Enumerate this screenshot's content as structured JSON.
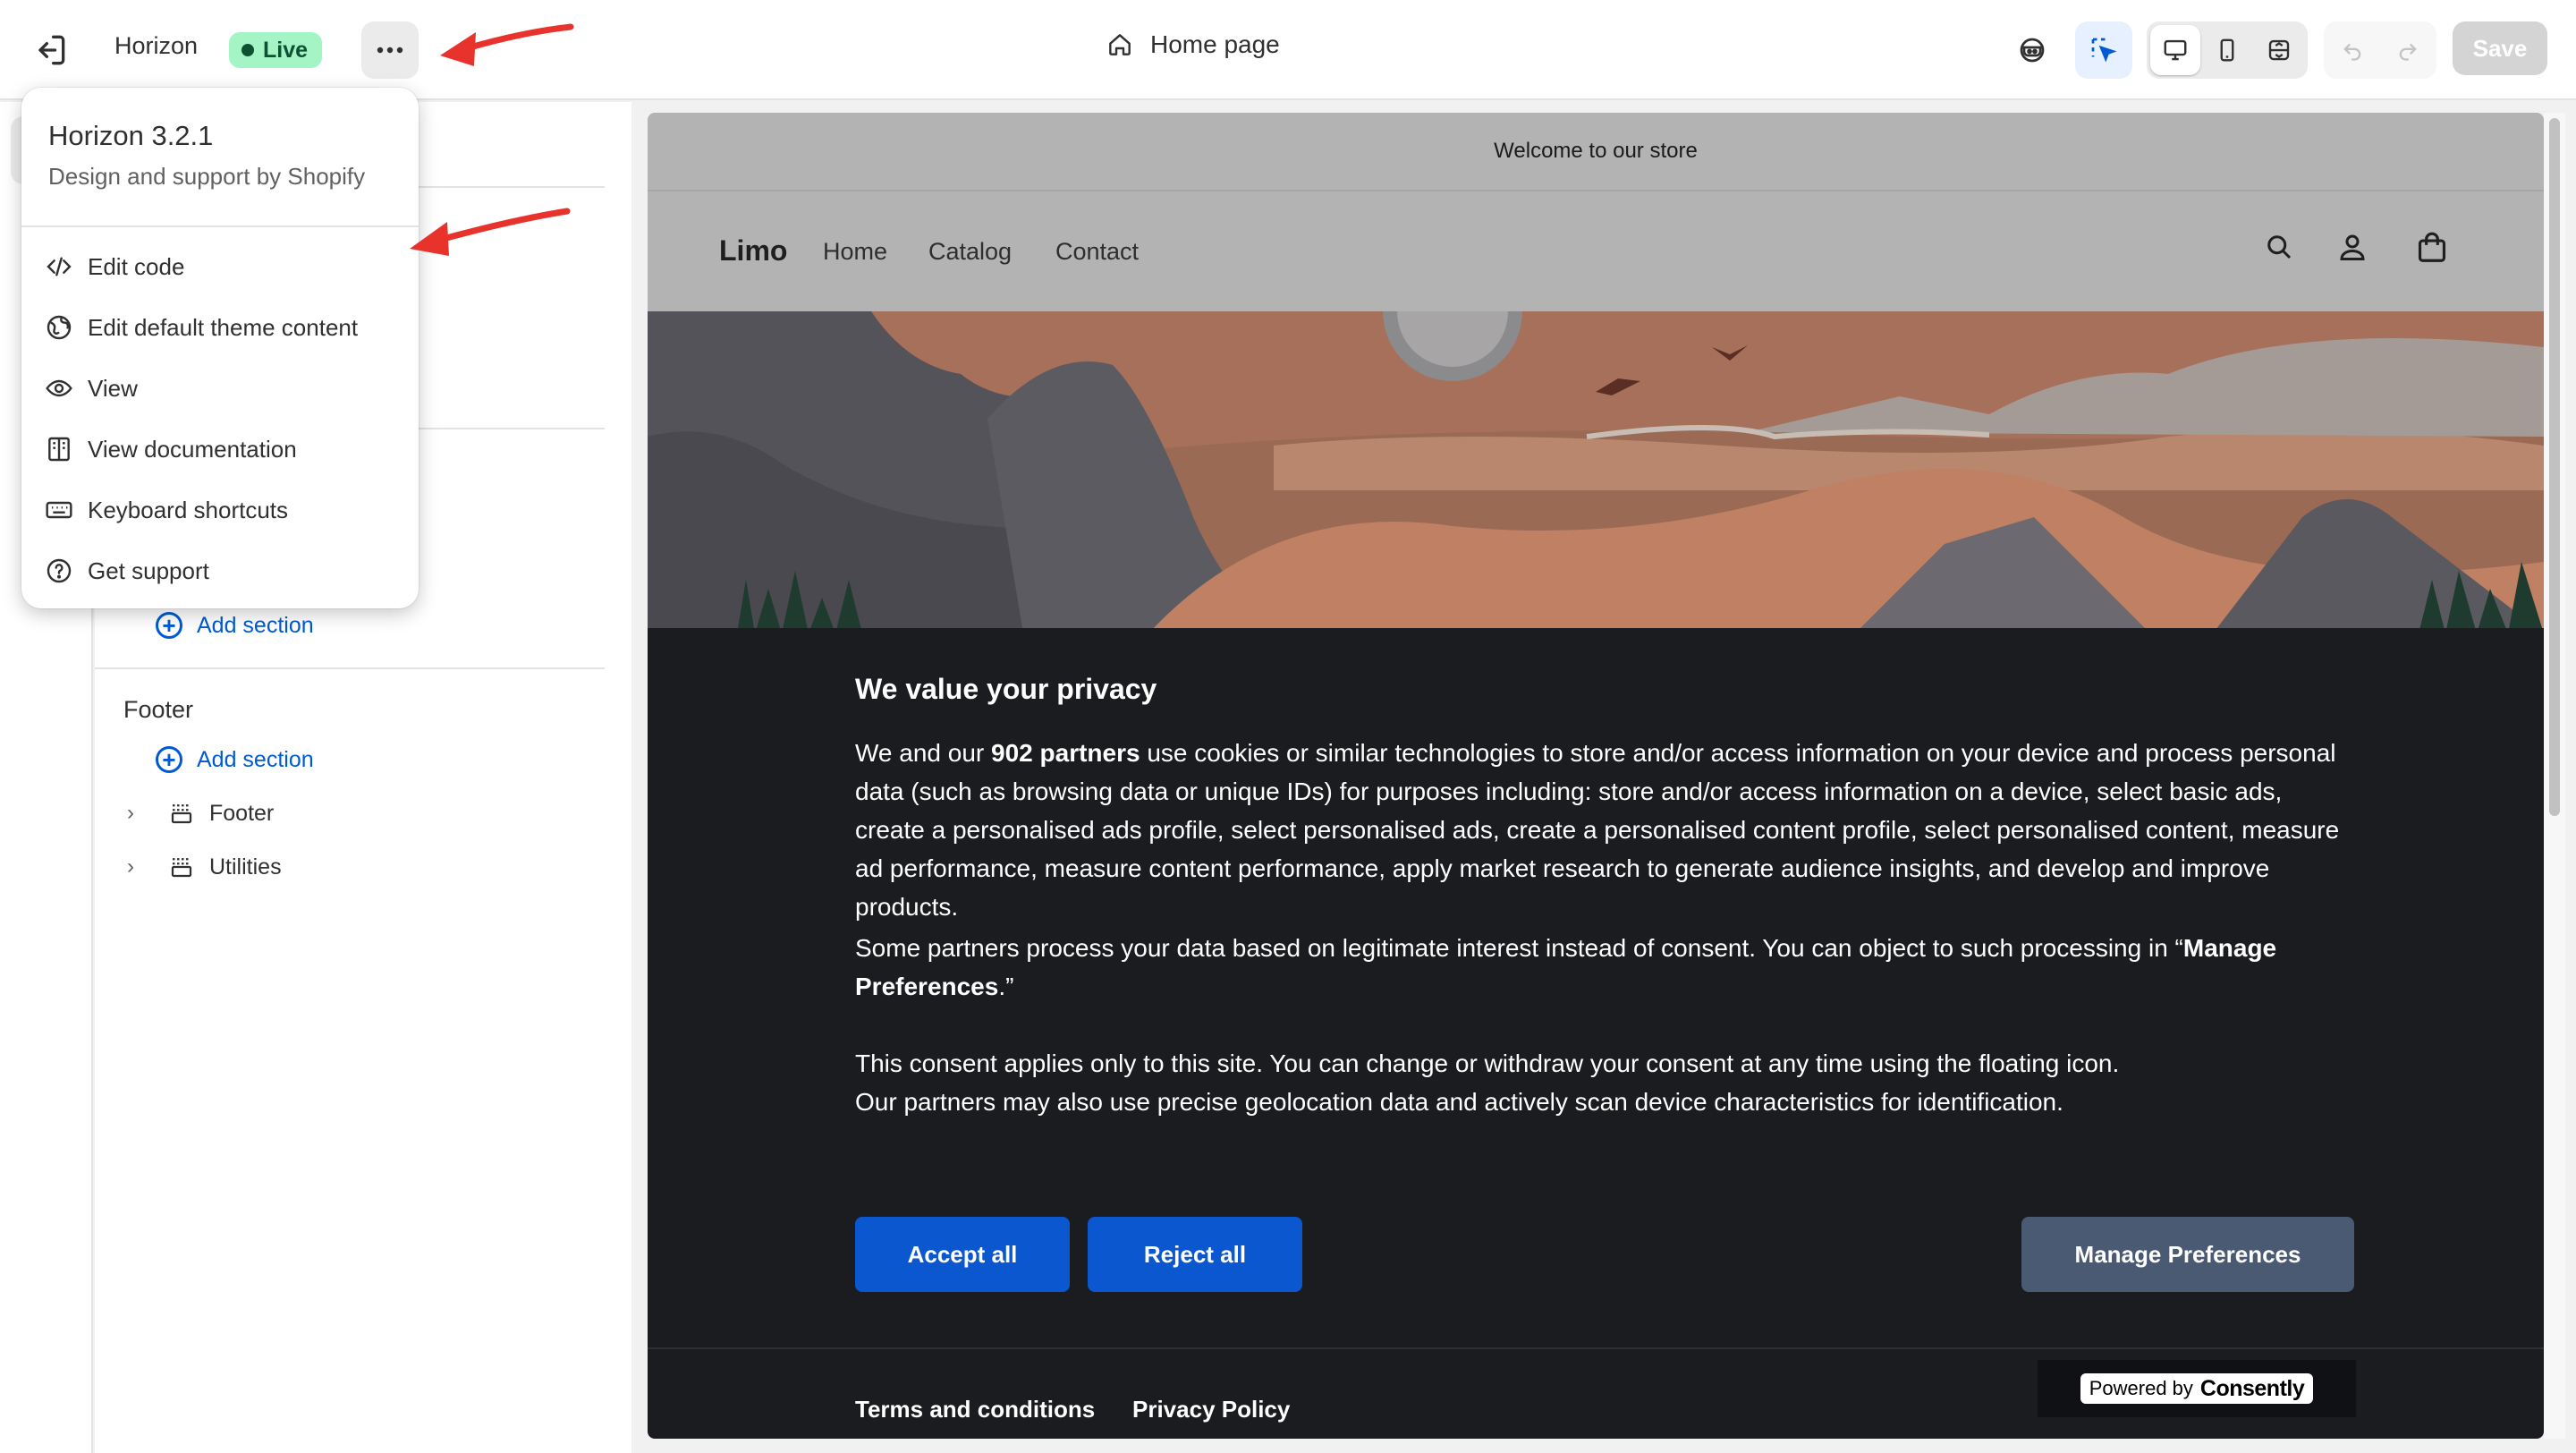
{
  "topbar": {
    "theme_name": "Horizon",
    "live_label": "Live",
    "page_label": "Home page",
    "save_label": "Save"
  },
  "menu": {
    "theme_name": "Horizon",
    "version": "3.2.1",
    "subtitle": "Design and support by Shopify",
    "items": [
      {
        "label": "Edit code",
        "icon": "code-icon"
      },
      {
        "label": "Edit default theme content",
        "icon": "globe-icon"
      },
      {
        "label": "View",
        "icon": "eye-icon"
      },
      {
        "label": "View documentation",
        "icon": "book-icon"
      },
      {
        "label": "Keyboard shortcuts",
        "icon": "keyboard-icon"
      },
      {
        "label": "Get support",
        "icon": "question-icon"
      }
    ]
  },
  "sidebar": {
    "add_section_label": "Add section",
    "footer_heading": "Footer",
    "footer_items": [
      {
        "label": "Footer"
      },
      {
        "label": "Utilities"
      }
    ]
  },
  "preview": {
    "announcement": "Welcome to our store",
    "logo": "Limo",
    "nav": [
      "Home",
      "Catalog",
      "Contact"
    ],
    "privacy": {
      "title": "We value your privacy",
      "p1_prefix": "We and our ",
      "p1_bold": "902 partners",
      "p1_rest": " use cookies or similar technologies to store and/or access information on your device and process personal data (such as browsing data or unique IDs) for purposes including: store and/or access information on a device, select basic ads, create a personalised ads profile, select personalised ads, create a personalised content profile, select personalised content, measure ad performance, measure content performance, apply market research to generate audience insights, and develop and improve products.",
      "p2_prefix": "Some partners process your data based on legitimate interest instead of consent. You can object to such processing in “",
      "p2_bold": "Manage Preferences",
      "p2_suffix": ".”",
      "p3_line1": "This consent applies only to this site. You can change or withdraw your consent at any time using the floating icon.",
      "p3_line2": "Our partners may also use precise geolocation data and actively scan device characteristics for identification.",
      "accept_label": "Accept all",
      "reject_label": "Reject all",
      "manage_label": "Manage Preferences",
      "terms_label": "Terms and conditions",
      "privacy_label": "Privacy Policy",
      "powered_by": "Powered by",
      "powered_brand": "Consently"
    }
  },
  "colors": {
    "live_badge": "#a4f4c5",
    "accent_blue": "#005bd3",
    "consent_blue": "#0b57d0",
    "consent_slate": "#4a5a72",
    "annotation_arrow": "#e8322c"
  }
}
